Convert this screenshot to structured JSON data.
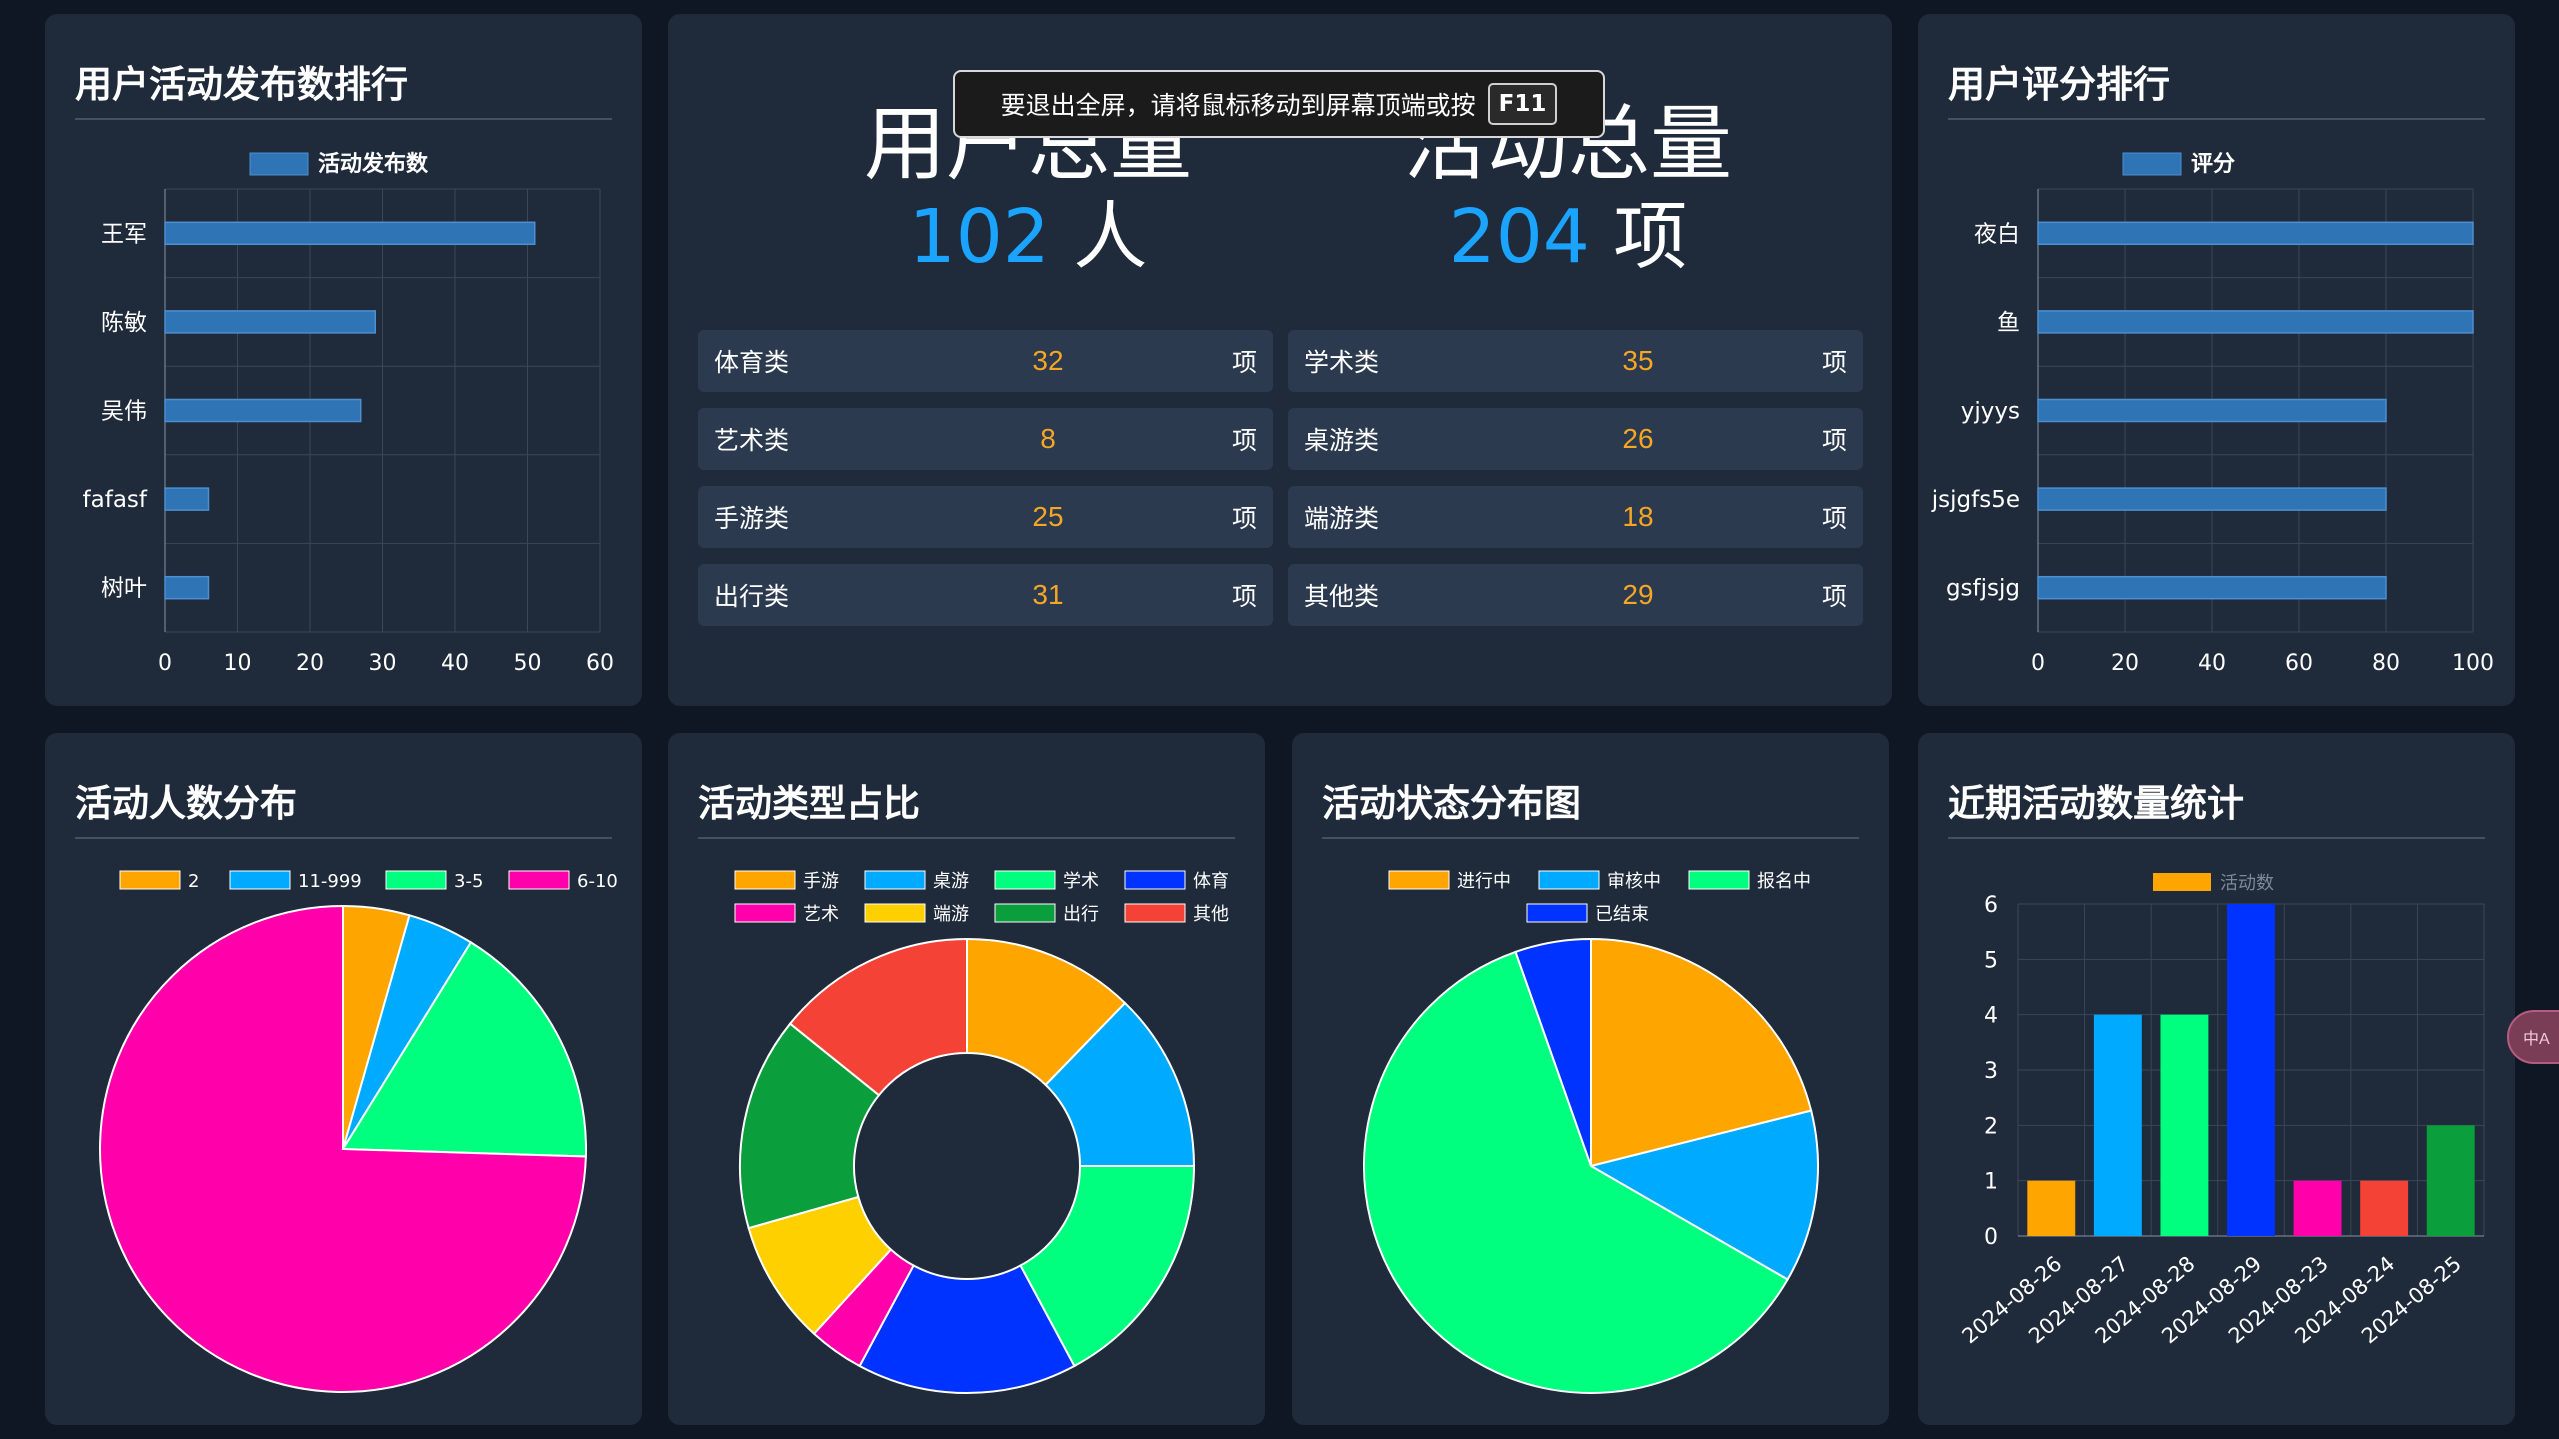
{
  "user_activity_rank": {
    "title": "用户活动发布数排行",
    "legend": "活动发布数",
    "names": [
      "王军",
      "陈敏",
      "吴伟",
      "fafasf",
      "树叶"
    ],
    "values": [
      51,
      29,
      27,
      6,
      6
    ],
    "x_ticks": [
      "0",
      "10",
      "20",
      "30",
      "40",
      "50",
      "60"
    ],
    "xlim": [
      0,
      60
    ],
    "bar_color": "#2f74b5"
  },
  "summary": {
    "users_label": "用户总量",
    "users_value": "102",
    "users_unit": "人",
    "activities_label": "活动总量",
    "activities_value": "204",
    "activities_unit": "项",
    "categories": [
      {
        "name": "体育类",
        "value": "32",
        "unit": "项"
      },
      {
        "name": "学术类",
        "value": "35",
        "unit": "项"
      },
      {
        "name": "艺术类",
        "value": "8",
        "unit": "项"
      },
      {
        "name": "桌游类",
        "value": "26",
        "unit": "项"
      },
      {
        "name": "手游类",
        "value": "25",
        "unit": "项"
      },
      {
        "name": "端游类",
        "value": "18",
        "unit": "项"
      },
      {
        "name": "出行类",
        "value": "31",
        "unit": "项"
      },
      {
        "name": "其他类",
        "value": "29",
        "unit": "项"
      }
    ]
  },
  "fullscreen_notice": {
    "text": "要退出全屏，请将鼠标移动到屏幕顶端或按",
    "key": "F11"
  },
  "user_score_rank": {
    "title": "用户评分排行",
    "legend": "评分",
    "names": [
      "夜白",
      "鱼",
      "yjyys",
      "jsjgfs5e",
      "gsfjsjg"
    ],
    "values": [
      100,
      100,
      80,
      80,
      80
    ],
    "x_ticks": [
      "0",
      "20",
      "40",
      "60",
      "80",
      "100"
    ],
    "xlim": [
      0,
      100
    ],
    "bar_color": "#2f74b5"
  },
  "people_distribution": {
    "title": "活动人数分布",
    "legend": [
      "2",
      "11-999",
      "3-5",
      "6-10"
    ],
    "values": [
      9,
      9,
      34,
      152
    ],
    "colors": [
      "#ffa500",
      "#00aaff",
      "#00ff7f",
      "#ff00aa"
    ]
  },
  "type_ratio": {
    "title": "活动类型占比",
    "legend": [
      "手游",
      "桌游",
      "学术",
      "体育",
      "艺术",
      "端游",
      "出行",
      "其他"
    ],
    "values": [
      25,
      26,
      35,
      32,
      8,
      18,
      31,
      29
    ],
    "colors": [
      "#ffa500",
      "#00aaff",
      "#00ff7f",
      "#0033ff",
      "#ff00aa",
      "#ffd000",
      "#0a9e3c",
      "#f44336"
    ]
  },
  "status_distribution": {
    "title": "活动状态分布图",
    "legend": [
      "进行中",
      "审核中",
      "报名中",
      "已结束"
    ],
    "values": [
      43,
      25,
      125,
      11
    ],
    "colors": [
      "#ffa500",
      "#00aaff",
      "#00ff7f",
      "#0033ff"
    ]
  },
  "recent_activity": {
    "title": "近期活动数量统计",
    "legend": "活动数",
    "categories": [
      "2024-08-26",
      "2024-08-27",
      "2024-08-28",
      "2024-08-29",
      "2024-08-23",
      "2024-08-24",
      "2024-08-25"
    ],
    "values": [
      1,
      4,
      4,
      6,
      1,
      1,
      2
    ],
    "colors": [
      "#ffa500",
      "#00aaff",
      "#00ff7f",
      "#0033ff",
      "#ff00aa",
      "#f44336",
      "#0a9e3c"
    ],
    "y_ticks": [
      "0",
      "1",
      "2",
      "3",
      "4",
      "5",
      "6"
    ],
    "ylim": [
      0,
      6
    ]
  },
  "chart_data": [
    {
      "type": "bar",
      "title": "用户活动发布数排行",
      "orientation": "horizontal",
      "categories": [
        "王军",
        "陈敏",
        "吴伟",
        "fafasf",
        "树叶"
      ],
      "series": [
        {
          "name": "活动发布数",
          "values": [
            51,
            29,
            27,
            6,
            6
          ]
        }
      ],
      "xlim": [
        0,
        60
      ],
      "grid": true,
      "legend_position": "top"
    },
    {
      "type": "bar",
      "title": "用户评分排行",
      "orientation": "horizontal",
      "categories": [
        "夜白",
        "鱼",
        "yjyys",
        "jsjgfs5e",
        "gsfjsjg"
      ],
      "series": [
        {
          "name": "评分",
          "values": [
            100,
            100,
            80,
            80,
            80
          ]
        }
      ],
      "xlim": [
        0,
        100
      ],
      "grid": true,
      "legend_position": "top"
    },
    {
      "type": "pie",
      "title": "活动人数分布",
      "categories": [
        "2",
        "11-999",
        "3-5",
        "6-10"
      ],
      "values": [
        9,
        9,
        34,
        152
      ],
      "legend_position": "top"
    },
    {
      "type": "pie",
      "title": "活动类型占比",
      "style": "donut",
      "categories": [
        "手游",
        "桌游",
        "学术",
        "体育",
        "艺术",
        "端游",
        "出行",
        "其他"
      ],
      "values": [
        25,
        26,
        35,
        32,
        8,
        18,
        31,
        29
      ],
      "legend_position": "top"
    },
    {
      "type": "pie",
      "title": "活动状态分布图",
      "categories": [
        "进行中",
        "审核中",
        "报名中",
        "已结束"
      ],
      "values": [
        43,
        25,
        125,
        11
      ],
      "legend_position": "top"
    },
    {
      "type": "bar",
      "title": "近期活动数量统计",
      "categories": [
        "2024-08-26",
        "2024-08-27",
        "2024-08-28",
        "2024-08-29",
        "2024-08-23",
        "2024-08-24",
        "2024-08-25"
      ],
      "series": [
        {
          "name": "活动数",
          "values": [
            1,
            4,
            4,
            6,
            1,
            1,
            2
          ]
        }
      ],
      "ylim": [
        0,
        6
      ],
      "grid": true,
      "legend_position": "top"
    }
  ]
}
